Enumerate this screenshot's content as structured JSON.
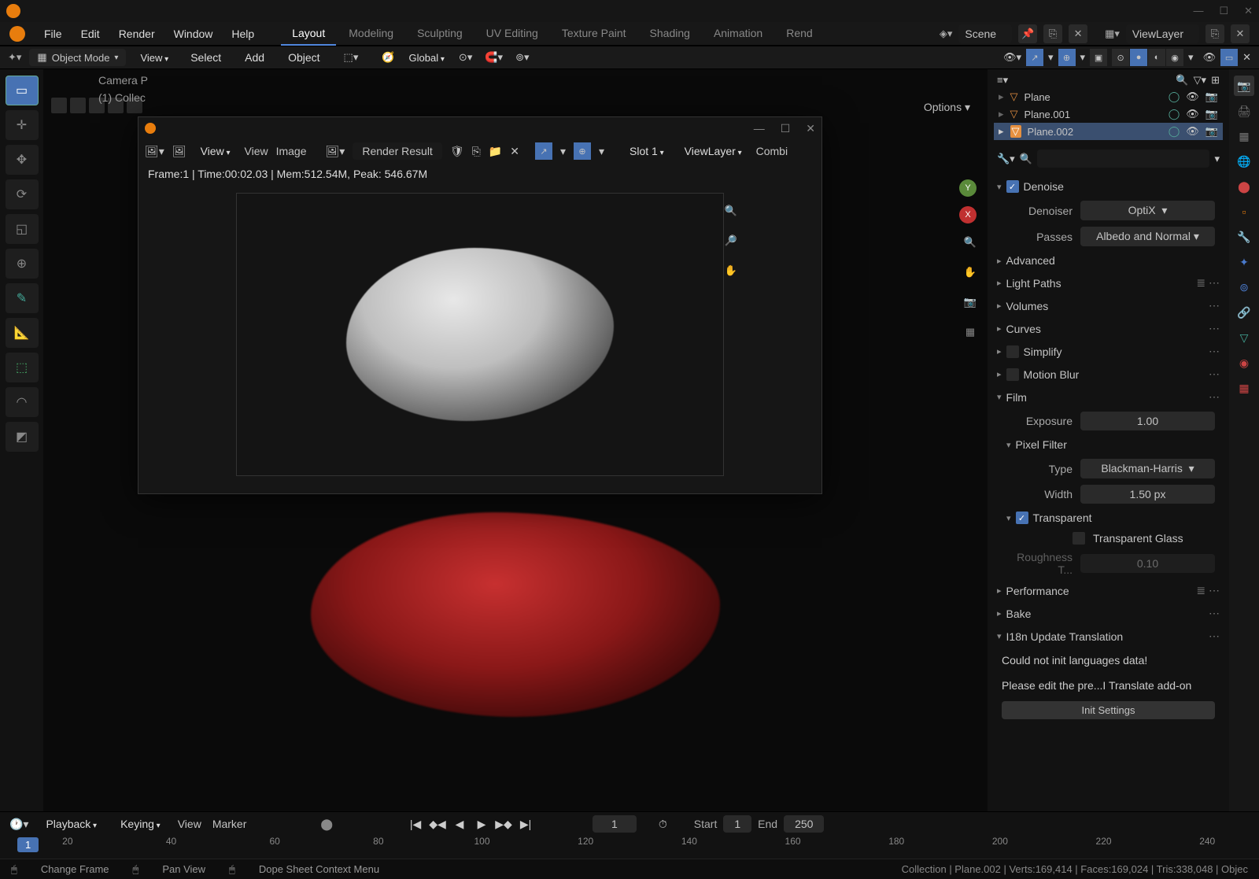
{
  "titlebar": {
    "win_min": "—",
    "win_max": "☐",
    "win_close": "✕"
  },
  "topmenu": {
    "file": "File",
    "edit": "Edit",
    "render": "Render",
    "window": "Window",
    "help": "Help"
  },
  "workspaces": {
    "layout": "Layout",
    "modeling": "Modeling",
    "sculpting": "Sculpting",
    "uv": "UV Editing",
    "texpaint": "Texture Paint",
    "shading": "Shading",
    "animation": "Animation",
    "rend": "Rend"
  },
  "scene": {
    "label": "Scene",
    "viewlayer": "ViewLayer"
  },
  "header3d": {
    "mode": "Object Mode",
    "view": "View",
    "select": "Select",
    "add": "Add",
    "object": "Object",
    "global": "Global",
    "options": "Options"
  },
  "viewport": {
    "cam": "Camera P",
    "collection": "(1) Collec"
  },
  "render_win": {
    "view_menu": "View",
    "view2": "View",
    "image": "Image",
    "result": "Render Result",
    "slot": "Slot 1",
    "viewlayer": "ViewLayer",
    "combined": "Combi",
    "stats": "Frame:1 | Time:00:02.03 | Mem:512.54M, Peak: 546.67M"
  },
  "outliner": {
    "items": [
      {
        "name": "Plane",
        "selected": false
      },
      {
        "name": "Plane.001",
        "selected": false
      },
      {
        "name": "Plane.002",
        "selected": true
      }
    ]
  },
  "props": {
    "search_placeholder": "",
    "denoise": {
      "label": "Denoise",
      "checked": true,
      "denoiser_label": "Denoiser",
      "denoiser_val": "OptiX",
      "passes_label": "Passes",
      "passes_val": "Albedo and Normal"
    },
    "advanced": "Advanced",
    "lightpaths": "Light Paths",
    "volumes": "Volumes",
    "curves": "Curves",
    "simplify": "Simplify",
    "motionblur": "Motion Blur",
    "film": {
      "label": "Film",
      "exposure_label": "Exposure",
      "exposure_val": "1.00",
      "pixel_filter": "Pixel Filter",
      "type_label": "Type",
      "type_val": "Blackman-Harris",
      "width_label": "Width",
      "width_val": "1.50 px",
      "transparent": "Transparent",
      "transparent_checked": true,
      "trans_glass": "Transparent Glass",
      "trans_glass_checked": false,
      "roughness_label": "Roughness T...",
      "roughness_val": "0.10"
    },
    "performance": "Performance",
    "bake": "Bake",
    "i18n": "I18n Update Translation",
    "err1": "Could not init languages data!",
    "err2": "Please edit the pre...I Translate add-on",
    "init_btn": "Init Settings"
  },
  "timeline": {
    "playback": "Playback",
    "keying": "Keying",
    "view": "View",
    "marker": "Marker",
    "cur_frame": "1",
    "start_label": "Start",
    "start_val": "1",
    "end_label": "End",
    "end_val": "250",
    "ticks": [
      "20",
      "40",
      "60",
      "80",
      "100",
      "120",
      "140",
      "160",
      "180",
      "200",
      "220",
      "240"
    ],
    "cur_marker": "1"
  },
  "statusbar": {
    "change_frame": "Change Frame",
    "pan": "Pan View",
    "context": "Dope Sheet Context Menu",
    "stats": "Collection | Plane.002 | Verts:169,414 | Faces:169,024 | Tris:338,048 | Objec"
  }
}
